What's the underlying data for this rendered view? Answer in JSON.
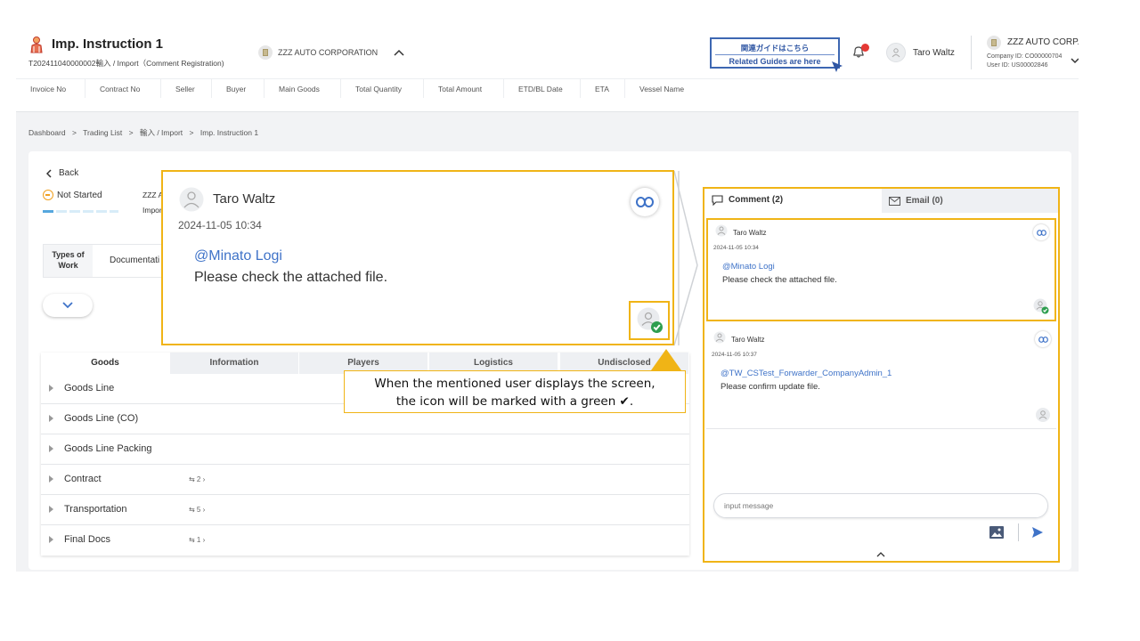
{
  "header": {
    "title": "Imp. Instruction 1",
    "subtitle": "T202411040000002輸入 / Import（Comment Registration)",
    "company": "ZZZ AUTO CORPORATION",
    "guide_line1": "関連ガイドはこちら",
    "guide_line2": "Related Guides are here",
    "user_name": "Taro Waltz",
    "corp_name": "ZZZ AUTO CORP.",
    "company_id": "Company ID: CO00000704",
    "user_id": "User ID: US00002846"
  },
  "columns": [
    "Invoice No",
    "Contract No",
    "Seller",
    "Buyer",
    "Main Goods",
    "Total Quantity",
    "Total Amount",
    "ETD/BL Date",
    "ETA",
    "Vessel Name"
  ],
  "breadcrumb": [
    "Dashboard",
    ">",
    "Trading List",
    ">",
    "輸入 / Import",
    ">",
    "Imp. Instruction 1"
  ],
  "main": {
    "back_label": "Back",
    "status": "Not Started",
    "frag1": "ZZZ A",
    "frag2": "Impor",
    "types_label": "Types of Work",
    "types_value": "Documentati"
  },
  "tabs": [
    "Goods",
    "Information",
    "Players",
    "Logistics",
    "Undisclosed"
  ],
  "rows": [
    {
      "label": "Goods Line",
      "count": ""
    },
    {
      "label": "Goods Line (CO)",
      "count": ""
    },
    {
      "label": "Goods Line Packing",
      "count": ""
    },
    {
      "label": "Contract",
      "count": "⇆ 2 ›"
    },
    {
      "label": "Transportation",
      "count": "⇆ 5 ›"
    },
    {
      "label": "Final Docs",
      "count": "⇆ 1 ›"
    }
  ],
  "comments": {
    "tab_comment": "Comment (2)",
    "tab_email": "Email (0)",
    "messages": [
      {
        "user": "Taro Waltz",
        "time": "2024-11-05 10:34",
        "mention": "@Minato Logi",
        "text": "Please check the attached file."
      },
      {
        "user": "Taro Waltz",
        "time": "2024-11-05 10:37",
        "mention": "@TW_CSTest_Forwarder_CompanyAdmin_1",
        "text": "Please confirm update file."
      }
    ],
    "input_placeholder": "input message"
  },
  "zoom": {
    "user": "Taro Waltz",
    "time": "2024-11-05 10:34",
    "mention": "@Minato Logi",
    "text": "Please check the attached file."
  },
  "callout": {
    "line1": "When the mentioned user displays the screen,",
    "line2": "the icon will be marked with a green ✔."
  },
  "colors": {
    "highlight": "#f0b416",
    "mention": "#3f73c8",
    "seen": "#2e9e4f",
    "guide": "#2f56a3",
    "bell_dot": "#e53935"
  }
}
